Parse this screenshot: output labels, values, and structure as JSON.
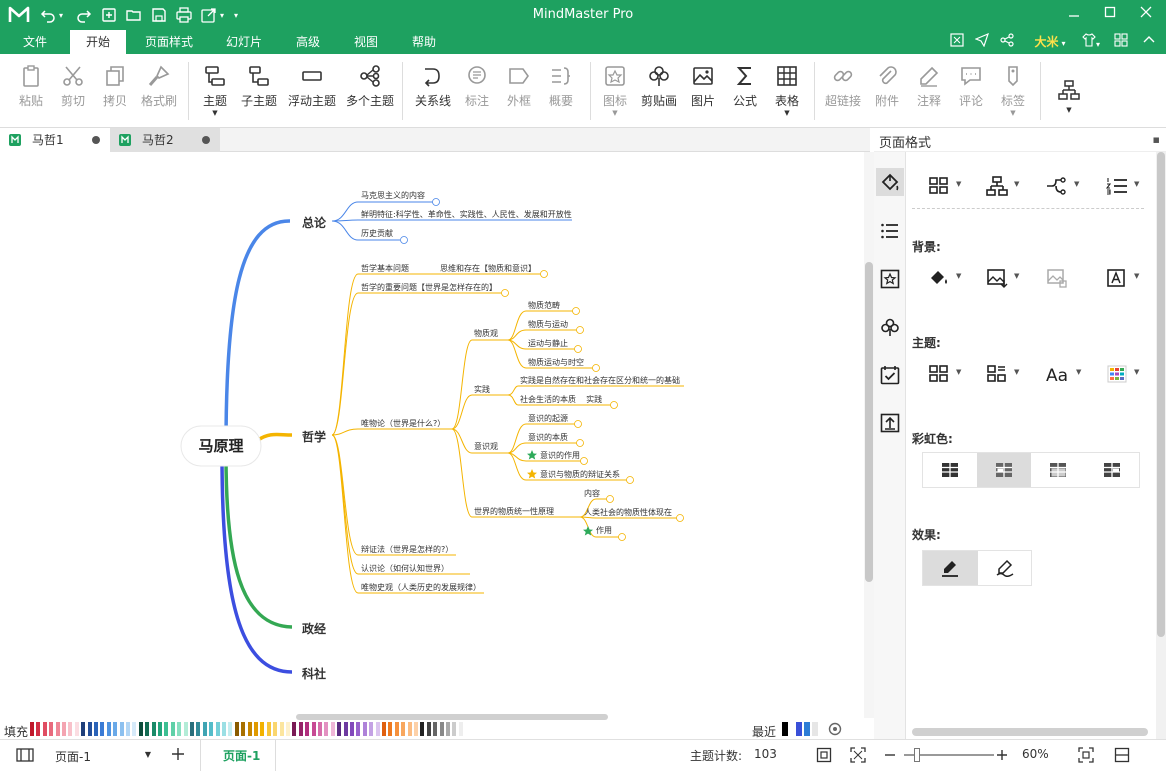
{
  "window": {
    "title": "MindMaster Pro"
  },
  "menu": {
    "items": [
      "文件",
      "开始",
      "页面样式",
      "幻灯片",
      "高级",
      "视图",
      "帮助"
    ],
    "active": "开始",
    "user": "大米"
  },
  "ribbon": {
    "buttons": [
      "粘贴",
      "剪切",
      "拷贝",
      "格式刷",
      "主题",
      "子主题",
      "浮动主题",
      "多个主题",
      "关系线",
      "标注",
      "外框",
      "概要",
      "图标",
      "剪贴画",
      "图片",
      "公式",
      "表格",
      "超链接",
      "附件",
      "注释",
      "评论",
      "标签"
    ]
  },
  "tabs": [
    {
      "label": "马哲1"
    },
    {
      "label": "马哲2"
    }
  ],
  "mindmap": {
    "root": "马原理",
    "branches": {
      "zonglun": "总论",
      "zhexue": "哲学",
      "zhengjing": "政经",
      "keshe": "科社"
    },
    "zonglun_items": [
      "马克思主义的内容",
      "鲜明特征:科学性、革命性、实践性、人民性、发展和开放性",
      "历史贡献"
    ],
    "zhexue": {
      "jiben": "哲学基本问题",
      "jiben_sub": "思维和存在【物质和意识】",
      "zhongyao": "哲学的重要问题【世界是怎样存在的】",
      "weiwu": "唯物论（世界是什么?）",
      "wuzhi": "物质观",
      "wuzhi_items": [
        "物质范畴",
        "物质与运动",
        "运动与静止",
        "物质运动与时空"
      ],
      "shijian": "实践",
      "shijian_items": [
        "实践是自然存在和社会存在区分和统一的基础",
        "社会生活的本质    实践"
      ],
      "yishi": "意识观",
      "yishi_items": [
        "意识的起源",
        "意识的本质",
        "意识的作用",
        "意识与物质的辩证关系"
      ],
      "tongyi": "世界的物质统一性原理",
      "tongyi_items": [
        "内容",
        "人类社会的物质性体现在",
        "作用"
      ],
      "bianzheng": "辩证法（世界是怎样的?）",
      "renshi": "认识论（如何认知世界）",
      "lishi": "唯物史观（人类历史的发展规律）"
    }
  },
  "panel": {
    "title": "页面格式",
    "sections": {
      "background": "背景:",
      "theme": "主题:",
      "rainbow": "彩虹色:",
      "effect": "效果:"
    }
  },
  "colorbar": {
    "fill_label": "填充",
    "recent_label": "最近"
  },
  "status": {
    "page_select": "页面-1",
    "page_tab": "页面-1",
    "topic_count_label": "主题计数:",
    "topic_count": "103",
    "zoom": "60%"
  }
}
